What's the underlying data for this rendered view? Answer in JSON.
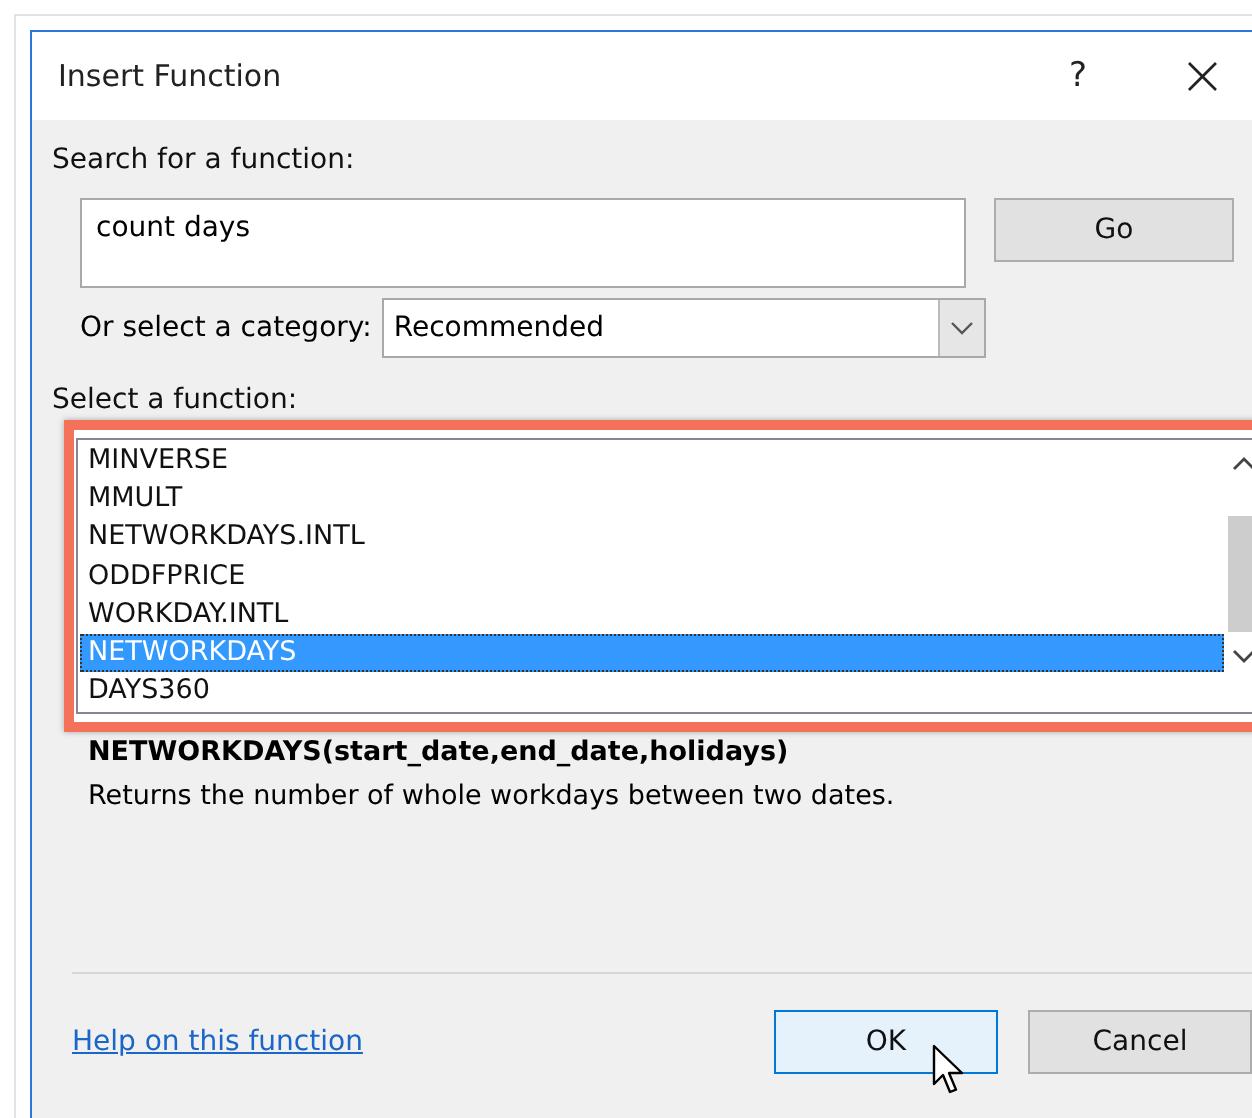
{
  "window": {
    "title": "Insert Function",
    "help_glyph": "?",
    "close_glyph": "×"
  },
  "search": {
    "label": "Search for a function:",
    "value": "count days",
    "button": "Go"
  },
  "category": {
    "label": "Or select a category:",
    "value": "Recommended"
  },
  "functions": {
    "label": "Select a function:",
    "items": [
      {
        "name": "MINVERSE",
        "selected": false
      },
      {
        "name": "MMULT",
        "selected": false
      },
      {
        "name": "NETWORKDAYS.INTL",
        "selected": false
      },
      {
        "name": "ODDFPRICE",
        "selected": false
      },
      {
        "name": "WORKDAY.INTL",
        "selected": false
      },
      {
        "name": "NETWORKDAYS",
        "selected": true
      },
      {
        "name": "DAYS360",
        "selected": false
      }
    ]
  },
  "signature": "NETWORKDAYS(start_date,end_date,holidays)",
  "description": "Returns the number of whole workdays between two dates.",
  "footer": {
    "help_link": "Help on this function",
    "buttons": [
      {
        "label": "OK",
        "kind": "default"
      },
      {
        "label": "Cancel",
        "kind": "normal"
      }
    ]
  }
}
